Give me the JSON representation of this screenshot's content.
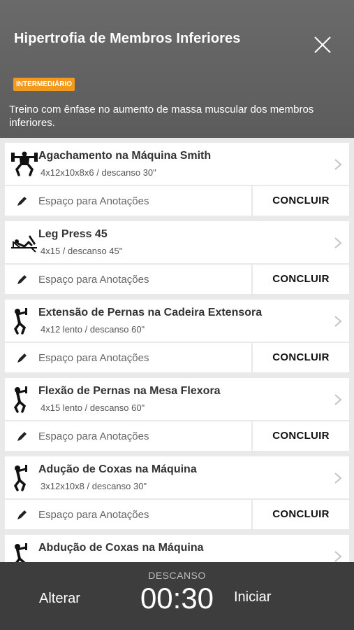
{
  "header": {
    "title": "Hipertrofia de Membros Inferiores",
    "close_icon": "close-icon",
    "level": "INTERMEDIÁRIO",
    "description": "Treino com ênfase no aumento de massa muscular dos membros inferiores."
  },
  "exercises": [
    {
      "name": "Agachamento na Máquina Smith",
      "detail": "4x12x10x8x6 / descanso 30\"",
      "icon": "smith-machine-icon",
      "notes_placeholder": "Espaço para Anotações",
      "conclude_label": "CONCLUIR"
    },
    {
      "name": "Leg Press 45",
      "detail": "4x15 / descanso 45\"",
      "icon": "leg-press-icon",
      "notes_placeholder": "Espaço para Anotações",
      "conclude_label": "CONCLUIR"
    },
    {
      "name": "Extensão de Pernas na Cadeira Extensora",
      "detail": "4x12 lento / descanso 60\"",
      "icon": "leg-extension-icon",
      "notes_placeholder": "Espaço para Anotações",
      "conclude_label": "CONCLUIR"
    },
    {
      "name": "Flexão de Pernas na Mesa Flexora",
      "detail": "4x15 lento / descanso 60\"",
      "icon": "leg-curl-icon",
      "notes_placeholder": "Espaço para Anotações",
      "conclude_label": "CONCLUIR"
    },
    {
      "name": "Adução de Coxas na Máquina",
      "detail": "3x12x10x8 / descanso 30\"",
      "icon": "adduction-icon",
      "notes_placeholder": "Espaço para Anotações",
      "conclude_label": "CONCLUIR"
    },
    {
      "name": "Abdução de Coxas na Máquina",
      "detail": "",
      "icon": "abduction-icon"
    }
  ],
  "footer": {
    "alter_label": "Alterar",
    "rest_label": "DESCANSO",
    "timer": "00:30",
    "start_label": "Iniciar"
  },
  "colors": {
    "header_bg": "#5f5f5f",
    "badge": "#f39a1e",
    "footer_bg": "#3d3d3d",
    "list_bg": "#e9e9e9"
  }
}
